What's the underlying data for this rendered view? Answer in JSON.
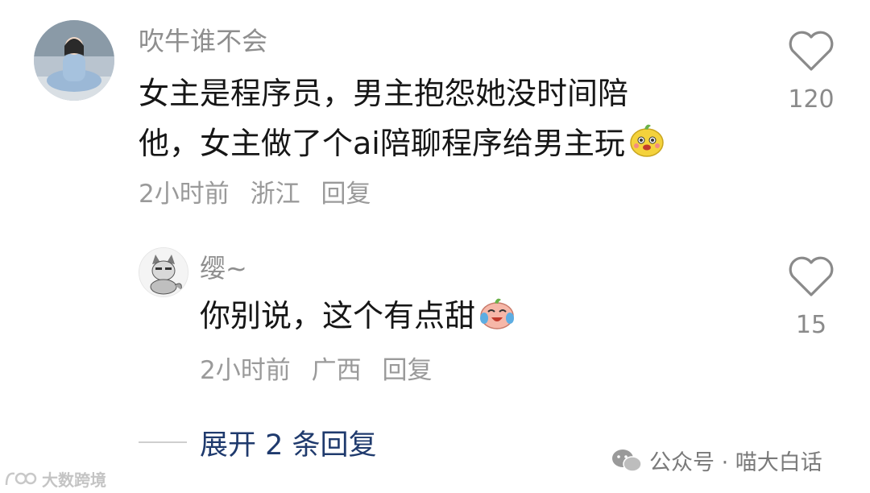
{
  "comment": {
    "username": "吹牛谁不会",
    "text_line1": "女主是程序员，男主抱怨她没时间陪",
    "text_line2": "他，女主做了个ai陪聊程序给男主玩",
    "emoji": "yellow-blob-face-emoji",
    "time": "2小时前",
    "location": "浙江",
    "reply_label": "回复",
    "like_count": "120"
  },
  "reply": {
    "username": "缨~",
    "text": "你别说，这个有点甜",
    "emoji": "laughing-crying-face-emoji",
    "time": "2小时前",
    "location": "广西",
    "reply_label": "回复",
    "like_count": "15"
  },
  "expand_replies": "展开 2 条回复",
  "watermark": {
    "wechat": "公众号 · 喵大白话",
    "logo_text": "大数跨境"
  },
  "colors": {
    "username": "#8e8e8e",
    "content": "#161616",
    "meta": "#9a9a9a",
    "expand": "#1f3a6d"
  }
}
